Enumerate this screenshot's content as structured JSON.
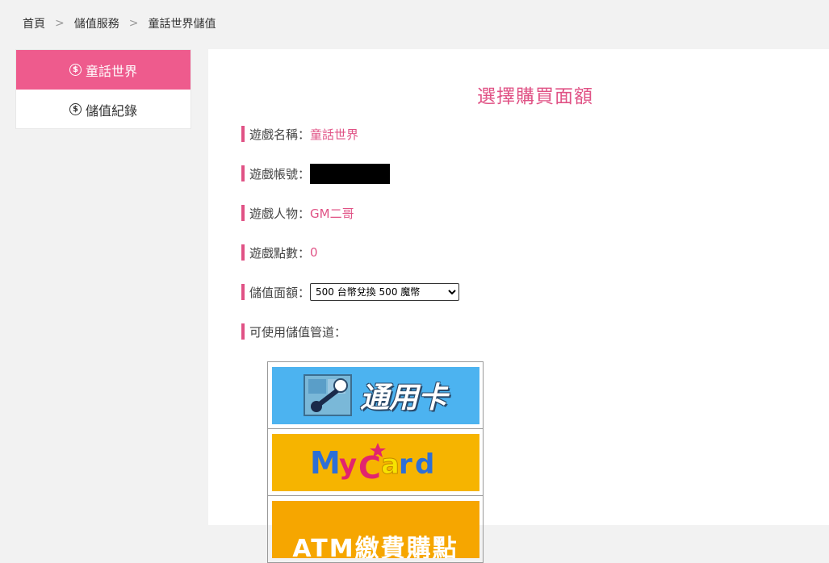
{
  "breadcrumb": {
    "items": [
      "首頁",
      "儲值服務",
      "童話世界儲值"
    ],
    "separator": ">"
  },
  "sidebar": {
    "items": [
      {
        "label": "童話世界",
        "icon": "dollar-coin-icon",
        "active": true
      },
      {
        "label": "儲值紀錄",
        "icon": "dollar-coin-icon",
        "active": false
      }
    ]
  },
  "main": {
    "title": "選擇購買面額",
    "fields": {
      "game_name_label": "遊戲名稱：",
      "game_name_value": "童話世界",
      "account_label": "遊戲帳號：",
      "character_label": "遊戲人物：",
      "character_value": "GM二哥",
      "points_label": "遊戲點數：",
      "points_value": "0",
      "amount_label": "儲值面額：",
      "amount_selected": "500 台幣兌換 500 魔幣",
      "channels_label": "可使用儲值管道："
    },
    "channels": [
      {
        "name": "gash",
        "text": "通用卡"
      },
      {
        "name": "mycard",
        "text": "MyCard"
      },
      {
        "name": "atm",
        "text": "ATM繳費購點"
      }
    ]
  },
  "colors": {
    "accent": "#e05285",
    "sidebar_active": "#ee5b8d",
    "page_bg": "#f2f2f2"
  }
}
